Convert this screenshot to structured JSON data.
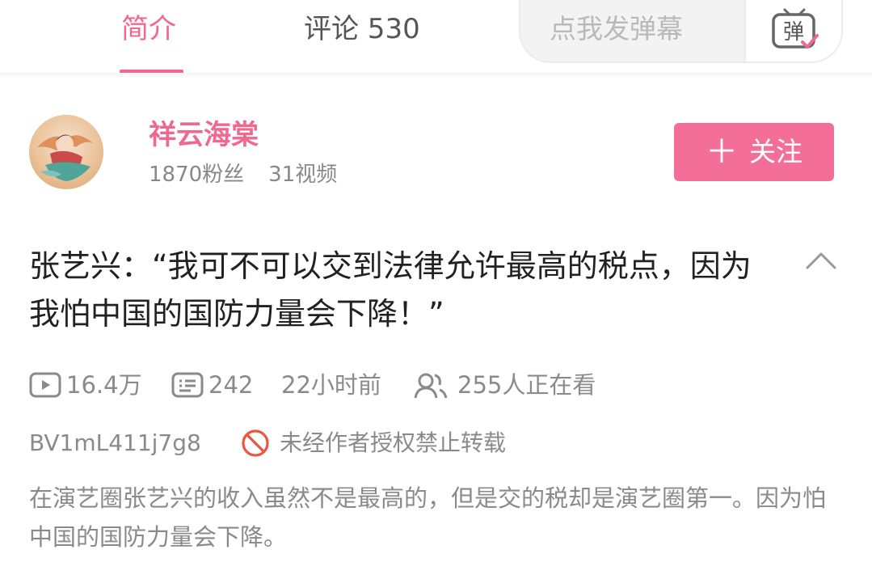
{
  "tabs": {
    "intro_label": "简介",
    "comments_label": "评论 530"
  },
  "danmaku": {
    "placeholder": "点我发弹幕",
    "button_glyph": "弹"
  },
  "uploader": {
    "name": "祥云海棠",
    "followers": "1870粉丝",
    "videos": "31视频",
    "follow_label": "关注",
    "follow_plus": "＋"
  },
  "video": {
    "title": "张艺兴：“我可不可以交到法律允许最高的税点，因为我怕中国的国防力量会下降！”",
    "plays": "16.4万",
    "danmaku_count": "242",
    "published": "22小时前",
    "watching": "255人正在看",
    "bvid": "BV1mL411j7g8",
    "copyright_notice": "未经作者授权禁止转载",
    "description": "在演艺圈张艺兴的收入虽然不是最高的，但是交的税却是演艺圈第一。因为怕中国的国防力量会下降。"
  },
  "icons": {
    "play": "play-icon",
    "danmaku": "danmaku-icon",
    "viewers": "viewers-icon",
    "forbidden": "forbidden-icon",
    "collapse": "chevron-up-icon",
    "danmaku_toggle": "danmaku-toggle-icon"
  },
  "colors": {
    "accent": "#f0688f",
    "follow_button": "#f46f97",
    "muted_text": "#8a8a8a",
    "forbidden": "#e8573f"
  }
}
